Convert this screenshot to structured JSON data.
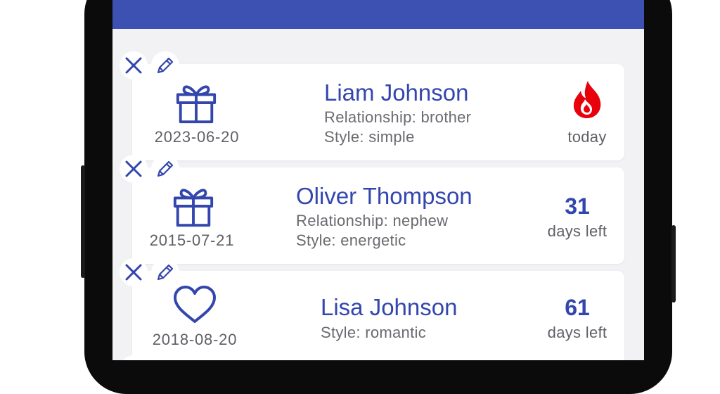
{
  "theme": {
    "appbar_color": "#3d51b2",
    "accent": "#3346ad",
    "flame": "#e8000b"
  },
  "entries": [
    {
      "icon": "gift-icon",
      "date": "2023-06-20",
      "name": "Liam Johnson",
      "relationship": "Relationship: brother",
      "style": "Style: simple",
      "status": "today",
      "status_icon": "flame-icon"
    },
    {
      "icon": "gift-icon",
      "date": "2015-07-21",
      "name": "Oliver Thompson",
      "relationship": "Relationship: nephew",
      "style": "Style: energetic",
      "days": "31",
      "status": "days left"
    },
    {
      "icon": "heart-icon",
      "date": "2018-08-20",
      "name": "Lisa Johnson",
      "style": "Style: romantic",
      "days": "61",
      "status": "days left"
    }
  ]
}
